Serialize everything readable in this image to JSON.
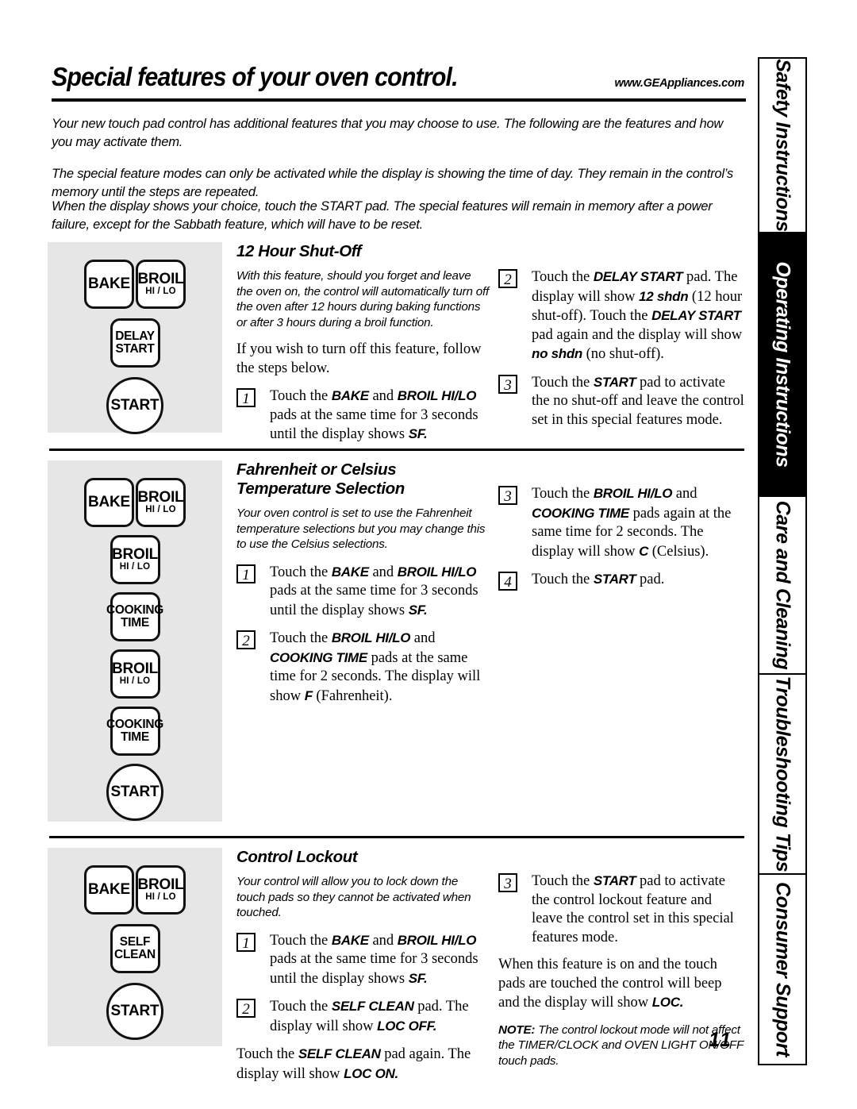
{
  "header": {
    "title": "Special features of your oven control.",
    "website": "www.GEAppliances.com"
  },
  "intro": {
    "p1": "Your new touch pad control has additional features that you may choose to use. The following are the features and how you may activate them.",
    "p2": "The special feature modes can only be activated while the display is showing the time of day. They remain in the control’s memory until the steps are repeated.",
    "p3": "When the display shows your choice, touch the START pad. The special features will remain in memory after a power failure, except for the Sabbath feature, which will have to be reset."
  },
  "tabs": [
    {
      "label": "Safety Instructions",
      "active": false
    },
    {
      "label": "Operating Instructions",
      "active": true
    },
    {
      "label": "Care and Cleaning",
      "active": false
    },
    {
      "label": "Troubleshooting Tips",
      "active": false
    },
    {
      "label": "Consumer Support",
      "active": false
    }
  ],
  "sections": [
    {
      "id": "12-hour-shut-off",
      "heading": "12 Hour Shut-Off",
      "blurb": "With this feature, should you forget and leave the oven on, the control will automatically turn off the oven after 12 hours during baking functions or after 3 hours during a broil function.",
      "para": "If you wish to turn off this feature, follow the steps below.",
      "keypad": [
        {
          "type": "pair",
          "keys": [
            {
              "line1": "BAKE",
              "line2": ""
            },
            {
              "line1": "BROIL",
              "line2": "HI / LO"
            }
          ]
        },
        {
          "type": "single",
          "keys": [
            {
              "line1": "DELAY",
              "line2": "START",
              "stacked": true
            }
          ]
        },
        {
          "type": "round",
          "keys": [
            {
              "line1": "START",
              "line2": ""
            }
          ]
        }
      ],
      "steps_left": [
        {
          "num": "1",
          "parts": [
            {
              "t": "Touch the ",
              "s": "n"
            },
            {
              "t": "BAKE",
              "s": "pad"
            },
            {
              "t": " and ",
              "s": "n"
            },
            {
              "t": "BROIL HI/LO",
              "s": "pad"
            },
            {
              "t": " pads at the same time for 3 seconds until the display shows ",
              "s": "n"
            },
            {
              "t": "SF.",
              "s": "disp"
            }
          ]
        }
      ],
      "steps_right": [
        {
          "num": "2",
          "parts": [
            {
              "t": "Touch the ",
              "s": "n"
            },
            {
              "t": "DELAY START",
              "s": "pad"
            },
            {
              "t": " pad. The display will show ",
              "s": "n"
            },
            {
              "t": "12 shdn",
              "s": "disp"
            },
            {
              "t": " (12 hour shut-off). Touch the ",
              "s": "n"
            },
            {
              "t": "DELAY START",
              "s": "pad"
            },
            {
              "t": " pad again and the display will show ",
              "s": "n"
            },
            {
              "t": "no shdn",
              "s": "disp"
            },
            {
              "t": " (no shut-off).",
              "s": "n"
            }
          ]
        },
        {
          "num": "3",
          "parts": [
            {
              "t": "Touch the ",
              "s": "n"
            },
            {
              "t": "START",
              "s": "pad"
            },
            {
              "t": " pad to activate the no shut-off and leave the control set in this special features mode.",
              "s": "n"
            }
          ]
        }
      ]
    },
    {
      "id": "fahrenheit-or-celsius",
      "heading": "Fahrenheit or Celsius Temperature Selection",
      "blurb": "Your oven control is set to use the Fahrenheit temperature selections but you may change this to use the Celsius selections.",
      "para": "",
      "keypad": [
        {
          "type": "pair",
          "keys": [
            {
              "line1": "BAKE",
              "line2": ""
            },
            {
              "line1": "BROIL",
              "line2": "HI / LO"
            }
          ]
        },
        {
          "type": "single",
          "keys": [
            {
              "line1": "BROIL",
              "line2": "HI / LO"
            }
          ]
        },
        {
          "type": "single",
          "keys": [
            {
              "line1": "COOKING",
              "line2": "TIME",
              "stacked": true
            }
          ]
        },
        {
          "type": "single",
          "keys": [
            {
              "line1": "BROIL",
              "line2": "HI / LO"
            }
          ]
        },
        {
          "type": "single",
          "keys": [
            {
              "line1": "COOKING",
              "line2": "TIME",
              "stacked": true
            }
          ]
        },
        {
          "type": "round",
          "keys": [
            {
              "line1": "START",
              "line2": ""
            }
          ]
        }
      ],
      "steps_left": [
        {
          "num": "1",
          "parts": [
            {
              "t": "Touch the ",
              "s": "n"
            },
            {
              "t": "BAKE",
              "s": "pad"
            },
            {
              "t": " and ",
              "s": "n"
            },
            {
              "t": "BROIL HI/LO",
              "s": "pad"
            },
            {
              "t": " pads at the same time for 3 seconds until the display shows ",
              "s": "n"
            },
            {
              "t": "SF.",
              "s": "disp"
            }
          ]
        },
        {
          "num": "2",
          "parts": [
            {
              "t": "Touch the ",
              "s": "n"
            },
            {
              "t": "BROIL HI/LO",
              "s": "pad"
            },
            {
              "t": " and ",
              "s": "n"
            },
            {
              "t": "COOKING TIME",
              "s": "pad"
            },
            {
              "t": " pads at the same time for 2 seconds. The display will show ",
              "s": "n"
            },
            {
              "t": "F",
              "s": "disp"
            },
            {
              "t": " (Fahrenheit).",
              "s": "n"
            }
          ]
        }
      ],
      "steps_right": [
        {
          "num": "3",
          "parts": [
            {
              "t": "Touch the ",
              "s": "n"
            },
            {
              "t": "BROIL HI/LO",
              "s": "pad"
            },
            {
              "t": " and ",
              "s": "n"
            },
            {
              "t": "COOKING TIME",
              "s": "pad"
            },
            {
              "t": " pads again at the same time for 2 seconds. The display will show ",
              "s": "n"
            },
            {
              "t": "C",
              "s": "disp"
            },
            {
              "t": " (Celsius).",
              "s": "n"
            }
          ]
        },
        {
          "num": "4",
          "parts": [
            {
              "t": "Touch the ",
              "s": "n"
            },
            {
              "t": "START",
              "s": "pad"
            },
            {
              "t": " pad.",
              "s": "n"
            }
          ]
        }
      ]
    },
    {
      "id": "control-lockout",
      "heading": "Control Lockout",
      "blurb": "Your control will allow you to lock down the touch pads so they cannot be activated when touched.",
      "para": "",
      "keypad": [
        {
          "type": "pair",
          "keys": [
            {
              "line1": "BAKE",
              "line2": ""
            },
            {
              "line1": "BROIL",
              "line2": "HI / LO"
            }
          ]
        },
        {
          "type": "single",
          "keys": [
            {
              "line1": "SELF",
              "line2": "CLEAN",
              "stacked": true
            }
          ]
        },
        {
          "type": "round",
          "keys": [
            {
              "line1": "START",
              "line2": ""
            }
          ]
        }
      ],
      "steps_left": [
        {
          "num": "1",
          "parts": [
            {
              "t": "Touch the ",
              "s": "n"
            },
            {
              "t": "BAKE",
              "s": "pad"
            },
            {
              "t": " and ",
              "s": "n"
            },
            {
              "t": "BROIL HI/LO",
              "s": "pad"
            },
            {
              "t": " pads at the same time for 3 seconds until the display shows ",
              "s": "n"
            },
            {
              "t": "SF.",
              "s": "disp"
            }
          ]
        },
        {
          "num": "2",
          "parts": [
            {
              "t": "Touch the ",
              "s": "n"
            },
            {
              "t": "SELF CLEAN",
              "s": "pad"
            },
            {
              "t": " pad. The display will show ",
              "s": "n"
            },
            {
              "t": "LOC OFF.",
              "s": "disp"
            }
          ]
        }
      ],
      "extra_left": [
        {
          "parts": [
            {
              "t": "Touch the ",
              "s": "n"
            },
            {
              "t": "SELF CLEAN",
              "s": "pad"
            },
            {
              "t": " pad again. The display will show ",
              "s": "n"
            },
            {
              "t": "LOC ON.",
              "s": "disp"
            }
          ]
        }
      ],
      "steps_right": [
        {
          "num": "3",
          "parts": [
            {
              "t": "Touch the ",
              "s": "n"
            },
            {
              "t": "START",
              "s": "pad"
            },
            {
              "t": " pad to activate the control lockout feature and leave the control set in this special features mode.",
              "s": "n"
            }
          ]
        }
      ],
      "extra_right": [
        {
          "parts": [
            {
              "t": "When this feature is on and the touch pads are touched the control will beep and the display will show ",
              "s": "n"
            },
            {
              "t": "LOC.",
              "s": "disp"
            }
          ]
        }
      ],
      "note_label": "NOTE:",
      "note_text": " The control lockout mode will not affect the TIMER/CLOCK and OVEN LIGHT ON/OFF touch pads."
    }
  ],
  "page_number": "11",
  "colors": {
    "panel_bg": "#e6e6e6",
    "ink": "#000000",
    "key_face": "#ffffff"
  }
}
